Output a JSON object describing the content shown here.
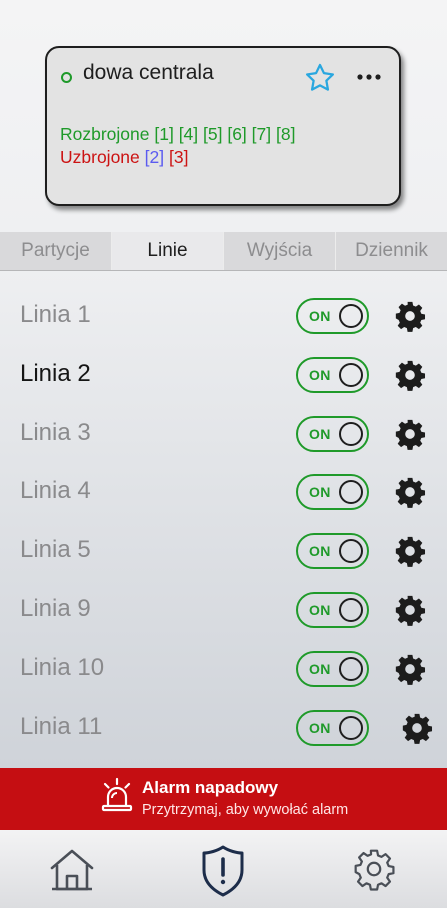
{
  "device": {
    "name": "dowa centrala",
    "status_color": "#1f9a2a",
    "armed_off_label": "Rozbrojone",
    "armed_off_zones": "[1] [4] [5] [6] [7] [8]",
    "armed_on_label": "Uzbrojone",
    "armed_on_zone_blue": "[2]",
    "armed_on_zone_red": "[3]",
    "favorite_icon": "star-icon",
    "menu_icon": "more-icon"
  },
  "tabs": [
    {
      "label": "Partycje",
      "active": false
    },
    {
      "label": "Linie",
      "active": true
    },
    {
      "label": "Wyjścia",
      "active": false
    },
    {
      "label": "Dziennik",
      "active": false
    }
  ],
  "lines": [
    {
      "label": "Linia 1",
      "toggle": "ON",
      "active": false
    },
    {
      "label": "Linia 2",
      "toggle": "ON",
      "active": true
    },
    {
      "label": "Linia 3",
      "toggle": "ON",
      "active": false
    },
    {
      "label": "Linia 4",
      "toggle": "ON",
      "active": false
    },
    {
      "label": "Linia 5",
      "toggle": "ON",
      "active": false
    },
    {
      "label": "Linia 9",
      "toggle": "ON",
      "active": false
    },
    {
      "label": "Linia 10",
      "toggle": "ON",
      "active": false
    },
    {
      "label": "Linia 11",
      "toggle": "ON",
      "active": false
    }
  ],
  "alarm": {
    "title": "Alarm napadowy",
    "subtitle": "Przytrzymaj, aby wywołać alarm",
    "color": "#c50e12",
    "icon": "alarm-siren-icon"
  },
  "nav": [
    {
      "icon": "home-icon"
    },
    {
      "icon": "shield-icon"
    },
    {
      "icon": "settings-gear-icon"
    }
  ],
  "colors": {
    "accent_green": "#1f9a2a",
    "accent_red": "#cc1313",
    "accent_blue": "#5b5bf0",
    "nav_dark": "#1d2d4a"
  }
}
